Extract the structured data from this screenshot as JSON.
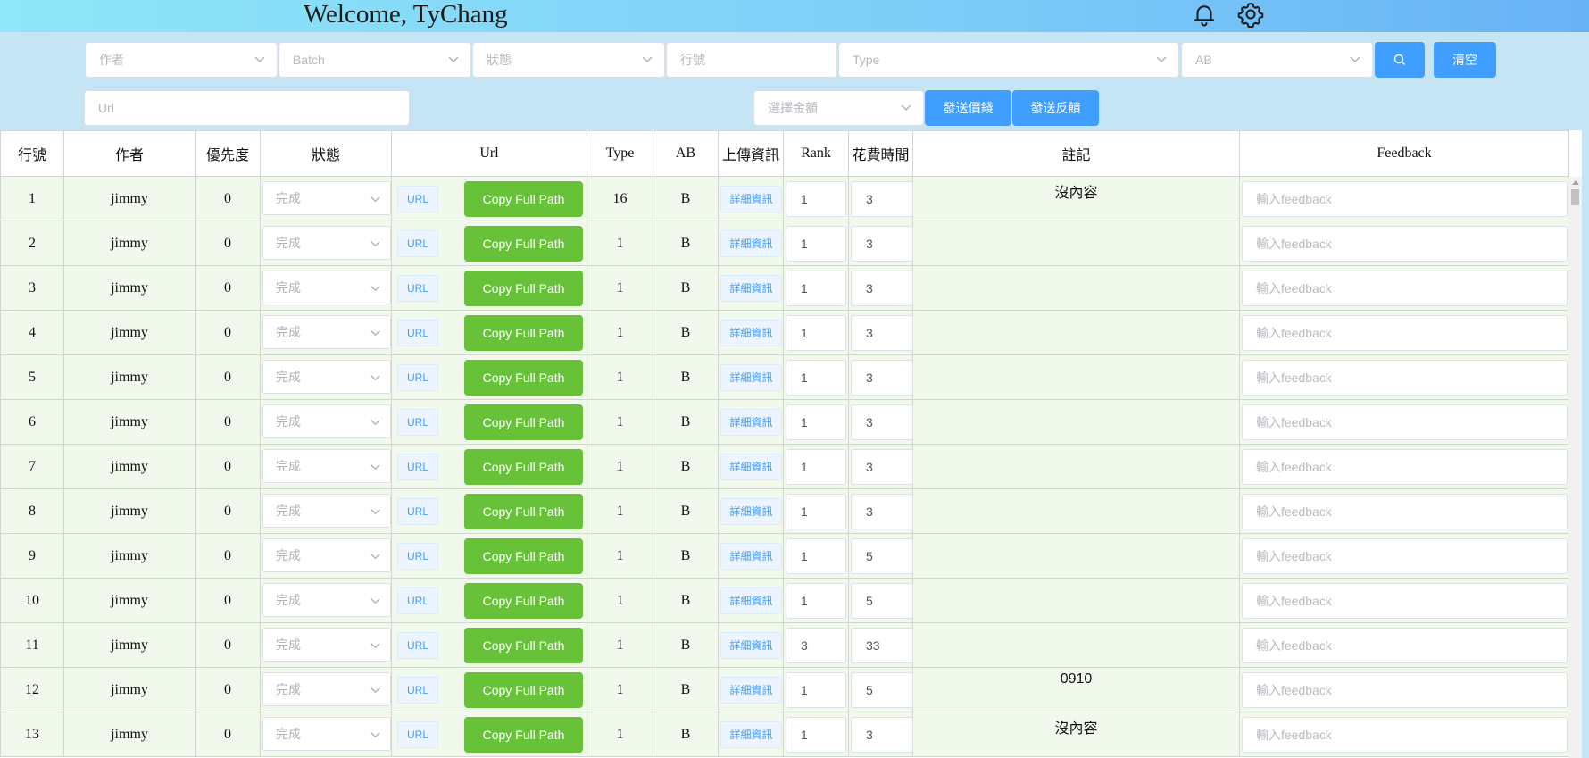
{
  "header": {
    "welcome": "Welcome, TyChang",
    "icons": [
      "bell-icon",
      "gear-icon"
    ]
  },
  "filters": {
    "author_placeholder": "作者",
    "batch_placeholder": "Batch",
    "status_placeholder": "狀態",
    "row_placeholder": "行號",
    "type_placeholder": "Type",
    "ab_placeholder": "AB",
    "clear_label": "清空",
    "url_placeholder": "Url",
    "amount_placeholder": "選擇金額",
    "send_price_label": "發送價錢",
    "send_feedback_label": "發送反饋"
  },
  "table": {
    "headers": [
      "行號",
      "作者",
      "優先度",
      "狀態",
      "Url",
      "Type",
      "AB",
      "上傳資訊",
      "Rank",
      "花費時間",
      "註記",
      "Feedback"
    ],
    "url_tag": "URL",
    "copy_label": "Copy Full Path",
    "info_label": "詳細資訊",
    "feedback_placeholder": "輸入feedback",
    "rows": [
      {
        "row": "1",
        "author": "jimmy",
        "priority": "0",
        "status": "完成",
        "type": "16",
        "ab": "B",
        "rank": "1",
        "time": "3",
        "note": "沒內容"
      },
      {
        "row": "2",
        "author": "jimmy",
        "priority": "0",
        "status": "完成",
        "type": "1",
        "ab": "B",
        "rank": "1",
        "time": "3",
        "note": ""
      },
      {
        "row": "3",
        "author": "jimmy",
        "priority": "0",
        "status": "完成",
        "type": "1",
        "ab": "B",
        "rank": "1",
        "time": "3",
        "note": ""
      },
      {
        "row": "4",
        "author": "jimmy",
        "priority": "0",
        "status": "完成",
        "type": "1",
        "ab": "B",
        "rank": "1",
        "time": "3",
        "note": ""
      },
      {
        "row": "5",
        "author": "jimmy",
        "priority": "0",
        "status": "完成",
        "type": "1",
        "ab": "B",
        "rank": "1",
        "time": "3",
        "note": ""
      },
      {
        "row": "6",
        "author": "jimmy",
        "priority": "0",
        "status": "完成",
        "type": "1",
        "ab": "B",
        "rank": "1",
        "time": "3",
        "note": ""
      },
      {
        "row": "7",
        "author": "jimmy",
        "priority": "0",
        "status": "完成",
        "type": "1",
        "ab": "B",
        "rank": "1",
        "time": "3",
        "note": ""
      },
      {
        "row": "8",
        "author": "jimmy",
        "priority": "0",
        "status": "完成",
        "type": "1",
        "ab": "B",
        "rank": "1",
        "time": "3",
        "note": ""
      },
      {
        "row": "9",
        "author": "jimmy",
        "priority": "0",
        "status": "完成",
        "type": "1",
        "ab": "B",
        "rank": "1",
        "time": "5",
        "note": ""
      },
      {
        "row": "10",
        "author": "jimmy",
        "priority": "0",
        "status": "完成",
        "type": "1",
        "ab": "B",
        "rank": "1",
        "time": "5",
        "note": ""
      },
      {
        "row": "11",
        "author": "jimmy",
        "priority": "0",
        "status": "完成",
        "type": "1",
        "ab": "B",
        "rank": "3",
        "time": "33",
        "note": ""
      },
      {
        "row": "12",
        "author": "jimmy",
        "priority": "0",
        "status": "完成",
        "type": "1",
        "ab": "B",
        "rank": "1",
        "time": "5",
        "note": "0910"
      },
      {
        "row": "13",
        "author": "jimmy",
        "priority": "0",
        "status": "完成",
        "type": "1",
        "ab": "B",
        "rank": "1",
        "time": "3",
        "note": "沒內容"
      }
    ]
  }
}
